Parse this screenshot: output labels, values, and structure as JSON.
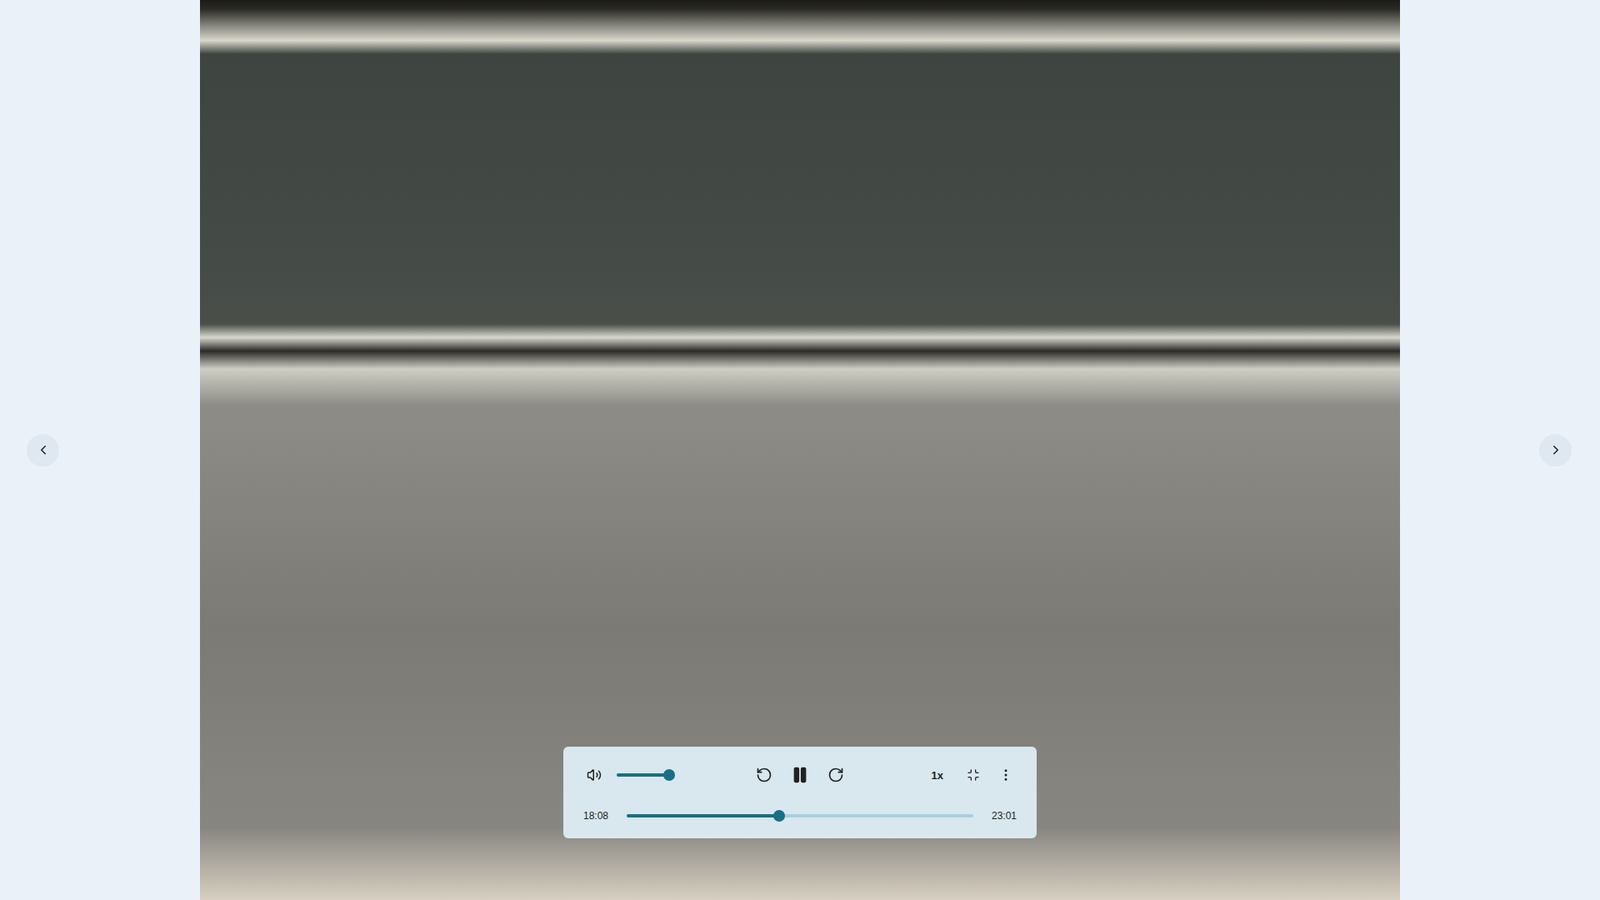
{
  "player": {
    "playing": true,
    "volume": {
      "muted": false,
      "level": 0.9
    },
    "speed": "1x",
    "elapsed": "18:08",
    "duration": "23:01",
    "progress": {
      "level": 0.44
    }
  }
}
